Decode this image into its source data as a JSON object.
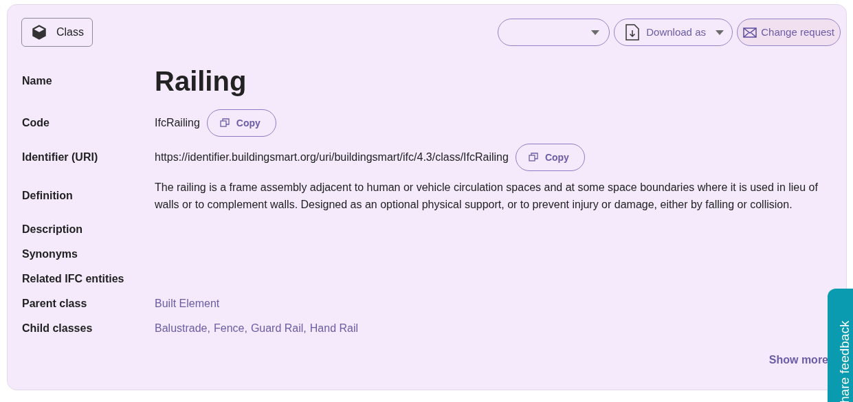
{
  "type_badge": {
    "label": "Class"
  },
  "toolbar": {
    "download": {
      "label": "Download as"
    },
    "change_request": {
      "label": "Change request"
    }
  },
  "fields": [
    {
      "kind": "title",
      "label": "Name",
      "value": "Railing"
    },
    {
      "kind": "copy",
      "label": "Code",
      "value": "IfcRailing",
      "button": "Copy"
    },
    {
      "kind": "copy",
      "label": "Identifier (URI)",
      "value": "https://identifier.buildingsmart.org/uri/buildingsmart/ifc/4.3/class/IfcRailing",
      "button": "Copy"
    },
    {
      "kind": "text",
      "label": "Definition",
      "value": "The railing is a frame assembly adjacent to human or vehicle circulation spaces and at some space boundaries where it is used in lieu of walls or to complement walls. Designed as an optional physical support, or to prevent injury or damage, either by falling or collision."
    },
    {
      "kind": "empty",
      "label": "Description"
    },
    {
      "kind": "empty",
      "label": "Synonyms"
    },
    {
      "kind": "empty",
      "label": "Related IFC entities"
    },
    {
      "kind": "links",
      "label": "Parent class",
      "links": [
        "Built Element"
      ]
    },
    {
      "kind": "links",
      "label": "Child classes",
      "links": [
        "Balustrade",
        "Fence",
        "Guard Rail",
        "Hand Rail"
      ],
      "separator": ","
    }
  ],
  "show_more": {
    "label": "Show more"
  },
  "feedback_tab": {
    "label": "hare feedback"
  }
}
